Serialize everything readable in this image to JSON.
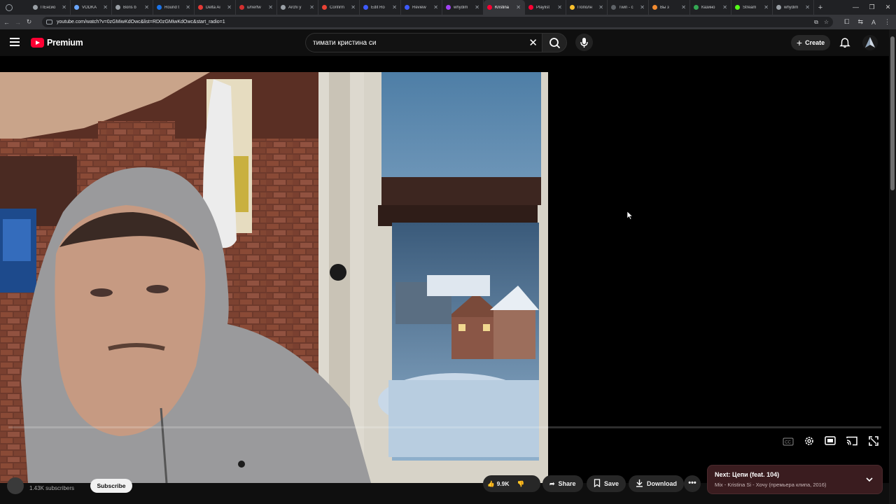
{
  "browser": {
    "tabs": [
      {
        "label": "ПЕнсио",
        "color": "#9aa0a6"
      },
      {
        "label": "VODKA",
        "color": "#6aa6ff"
      },
      {
        "label": "Boris b",
        "color": "#9aa0a6"
      },
      {
        "label": "Round t",
        "color": "#1a73e8"
      },
      {
        "label": "Delta Ai",
        "color": "#e53935"
      },
      {
        "label": "u/nerfw",
        "color": "#d32f2f"
      },
      {
        "label": "Archi y",
        "color": "#9aa0a6"
      },
      {
        "label": "Confirm",
        "color": "#ea4335"
      },
      {
        "label": "Edit Ro",
        "color": "#3d5afe"
      },
      {
        "label": "Review",
        "color": "#3d5afe"
      },
      {
        "label": "whydim",
        "color": "#a142f4"
      },
      {
        "label": "Kristina",
        "color": "#ff0033",
        "active": true
      },
      {
        "label": "Playlist",
        "color": "#ff0033"
      },
      {
        "label": "Пополн",
        "color": "#fbc02d"
      },
      {
        "label": "Twin - c",
        "color": "#5f6368"
      },
      {
        "label": "Вы з",
        "color": "#f28b30"
      },
      {
        "label": "Казино",
        "color": "#34a853"
      },
      {
        "label": "Stream",
        "color": "#53fc18"
      },
      {
        "label": "whydim",
        "color": "#9aa0a6"
      }
    ],
    "new_tab": "+",
    "url": "youtube.com/watch?v=0zGMiwKdOwc&list=RD0zGMiwKdOwc&start_radio=1"
  },
  "youtube": {
    "logo_text": "Premium",
    "search_query": "тимати кристина си",
    "create_label": "Create"
  },
  "below": {
    "subscribers": "1.43K subscribers",
    "subscribe_label": "Subscribe",
    "likes": "9.9K",
    "share_label": "Share",
    "save_label": "Save",
    "download_label": "Download",
    "more_label": "•••"
  },
  "next": {
    "title": "Next: Цепи (feat. 104)",
    "subtitle": "Mix - Kristina Si - Хочу (премьера клипа, 2016)"
  },
  "colors": {
    "accent": "#ff0033",
    "next_bg": "#3a1c1f"
  }
}
